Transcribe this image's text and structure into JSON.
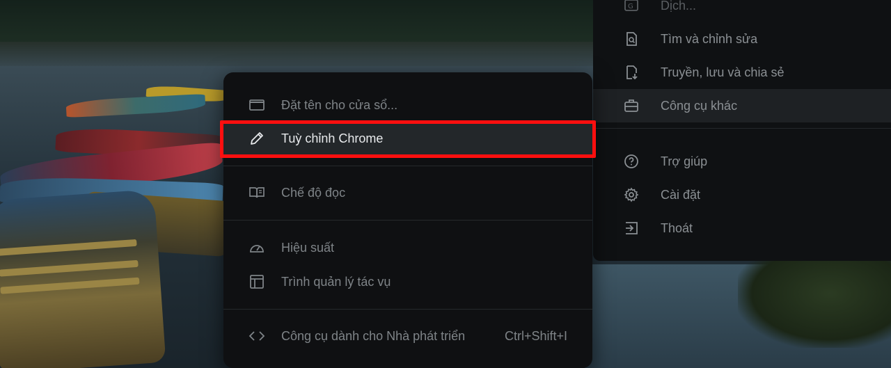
{
  "side_menu": {
    "items": [
      {
        "label": "Dịch...",
        "icon": "translate-icon"
      },
      {
        "label": "Tìm và chỉnh sửa",
        "icon": "find-edit-icon"
      },
      {
        "label": "Truyền, lưu và chia sẻ",
        "icon": "cast-save-share-icon"
      },
      {
        "label": "Công cụ khác",
        "icon": "toolbox-icon"
      },
      {
        "label": "Trợ giúp",
        "icon": "help-icon"
      },
      {
        "label": "Cài đặt",
        "icon": "gear-icon"
      },
      {
        "label": "Thoát",
        "icon": "exit-icon"
      }
    ]
  },
  "submenu": {
    "items": [
      {
        "label": "Đặt tên cho cửa sổ...",
        "icon": "window-icon"
      },
      {
        "label": "Tuỳ chỉnh Chrome",
        "icon": "pencil-icon"
      },
      {
        "label": "Chế độ đọc",
        "icon": "book-icon"
      },
      {
        "label": "Hiệu suất",
        "icon": "speedometer-icon"
      },
      {
        "label": "Trình quản lý tác vụ",
        "icon": "task-manager-icon"
      },
      {
        "label": "Công cụ dành cho Nhà phát triển",
        "icon": "code-icon",
        "shortcut": "Ctrl+Shift+I"
      }
    ]
  },
  "colors": {
    "highlight_border": "#ff0f0f",
    "menu_bg": "#0f1113",
    "active_bg": "#23272a"
  }
}
